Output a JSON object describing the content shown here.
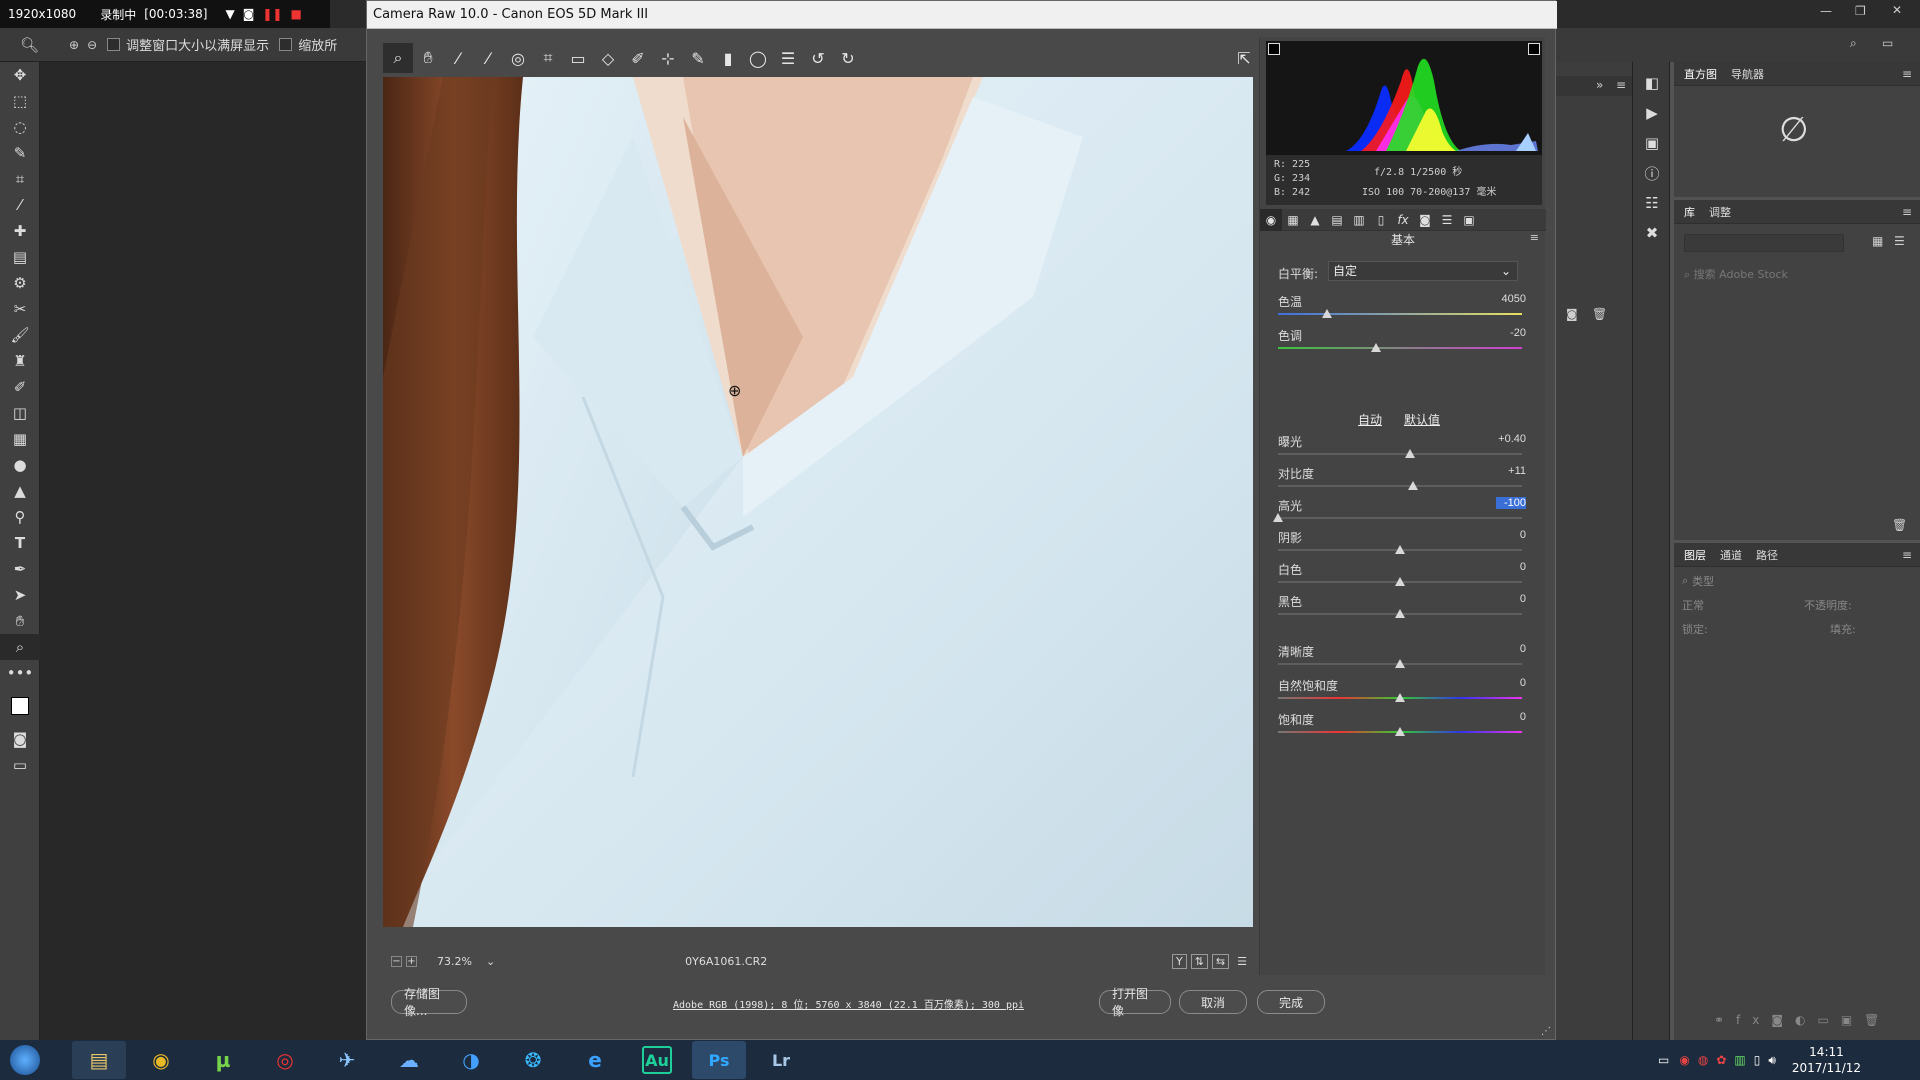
{
  "recorder": {
    "resolution": "1920x1080",
    "status": "录制中",
    "timer": "[00:03:38]"
  },
  "ps_options": {
    "fit_label": "调整窗口大小以满屏显示",
    "zoom_all_label": "缩放所"
  },
  "dialog": {
    "title": "Camera Raw 10.0 - Canon EOS 5D Mark III",
    "zoom": "73.2%",
    "filename": "0Y6A1061.CR2",
    "workflow": "Adobe RGB (1998); 8 位; 5760 x 3840 (22.1 百万像素); 300 ppi",
    "buttons": {
      "save": "存储图像...",
      "open": "打开图像",
      "cancel": "取消",
      "done": "完成"
    }
  },
  "info": {
    "r": "R: 225",
    "g": "G: 234",
    "b": "B: 242",
    "exposure": "f/2.8   1/2500 秒",
    "lens": "ISO 100   70-200@137 毫米"
  },
  "basic": {
    "section": "基本",
    "wb_label": "白平衡:",
    "wb_value": "自定",
    "auto": "自动",
    "default": "默认值",
    "sliders": [
      {
        "label": "色温",
        "value": "4050",
        "pos": 0.2
      },
      {
        "label": "色调",
        "value": "-20",
        "pos": 0.4
      },
      {
        "label": "曝光",
        "value": "+0.40",
        "pos": 0.54
      },
      {
        "label": "对比度",
        "value": "+11",
        "pos": 0.555
      },
      {
        "label": "高光",
        "value": "-100",
        "pos": 0.0
      },
      {
        "label": "阴影",
        "value": "0",
        "pos": 0.5
      },
      {
        "label": "白色",
        "value": "0",
        "pos": 0.5
      },
      {
        "label": "黑色",
        "value": "0",
        "pos": 0.5
      },
      {
        "label": "清晰度",
        "value": "0",
        "pos": 0.5
      },
      {
        "label": "自然饱和度",
        "value": "0",
        "pos": 0.5
      },
      {
        "label": "饱和度",
        "value": "0",
        "pos": 0.5
      }
    ]
  },
  "ps_panels": {
    "tab1": "直方图",
    "tab2": "导航器",
    "lib": "库",
    "adj": "调整",
    "search": "搜索 Adobe Stock",
    "layers": "图层",
    "channels": "通道",
    "paths": "路径",
    "kind": "类型",
    "blend": "正常",
    "opacity": "不透明度:",
    "lock": "锁定:",
    "fill": "填充:"
  },
  "taskbar": {
    "apps": [
      "Au",
      "Ps",
      "Lr"
    ],
    "time": "14:11",
    "date": "2017/11/12"
  }
}
